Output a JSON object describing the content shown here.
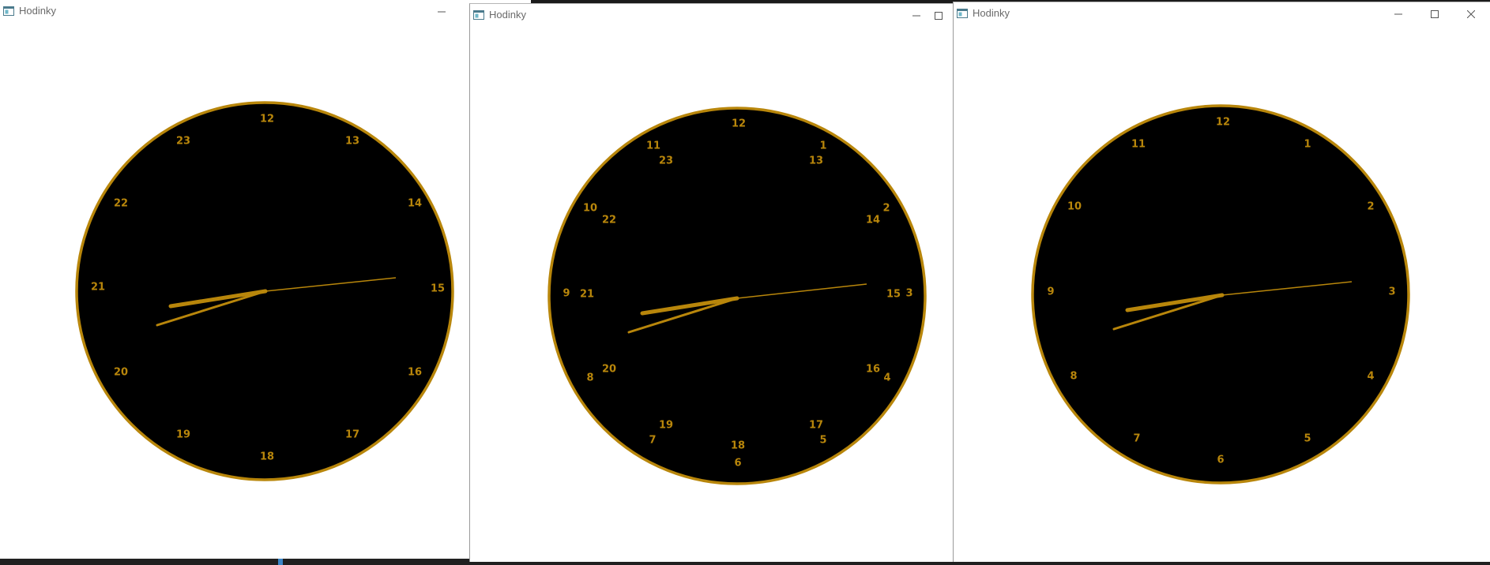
{
  "colors": {
    "window_background": "#ffffff",
    "clock_face": "#000000",
    "clock_accent": "#b8860b",
    "title_text": "#6a6a6a"
  },
  "windows": [
    {
      "title": "Hodinky",
      "icon": "app-window-icon",
      "controls": [
        "minimize-icon"
      ],
      "clock": {
        "numerals": [
          "12",
          "13",
          "14",
          "15",
          "16",
          "17",
          "18",
          "19",
          "20",
          "21",
          "22",
          "23"
        ],
        "hands": {
          "hour_hand": "8:30",
          "minute_hand": "41 min",
          "second_hand": "14 s"
        }
      }
    },
    {
      "title": "Hodinky",
      "icon": "app-window-icon",
      "controls": [
        "minimize-icon",
        "maximize-icon"
      ],
      "clock": {
        "numerals_outer": [
          "12",
          "1",
          "2",
          "3",
          "4",
          "5",
          "6",
          "7",
          "8",
          "9",
          "10",
          "11"
        ],
        "numerals_inner": [
          "13",
          "14",
          "15",
          "16",
          "17",
          "18",
          "19",
          "20",
          "21",
          "22",
          "23"
        ],
        "hands": {
          "hour_hand": "8:30",
          "minute_hand": "41 min",
          "second_hand": "14 s"
        }
      }
    },
    {
      "title": "Hodinky",
      "icon": "app-window-icon",
      "controls": [
        "minimize-icon",
        "maximize-icon",
        "close-icon"
      ],
      "clock": {
        "numerals": [
          "12",
          "1",
          "2",
          "3",
          "4",
          "5",
          "6",
          "7",
          "8",
          "9",
          "10",
          "11"
        ],
        "hands": {
          "hour_hand": "8:30",
          "minute_hand": "41 min",
          "second_hand": "14 s"
        }
      }
    }
  ]
}
